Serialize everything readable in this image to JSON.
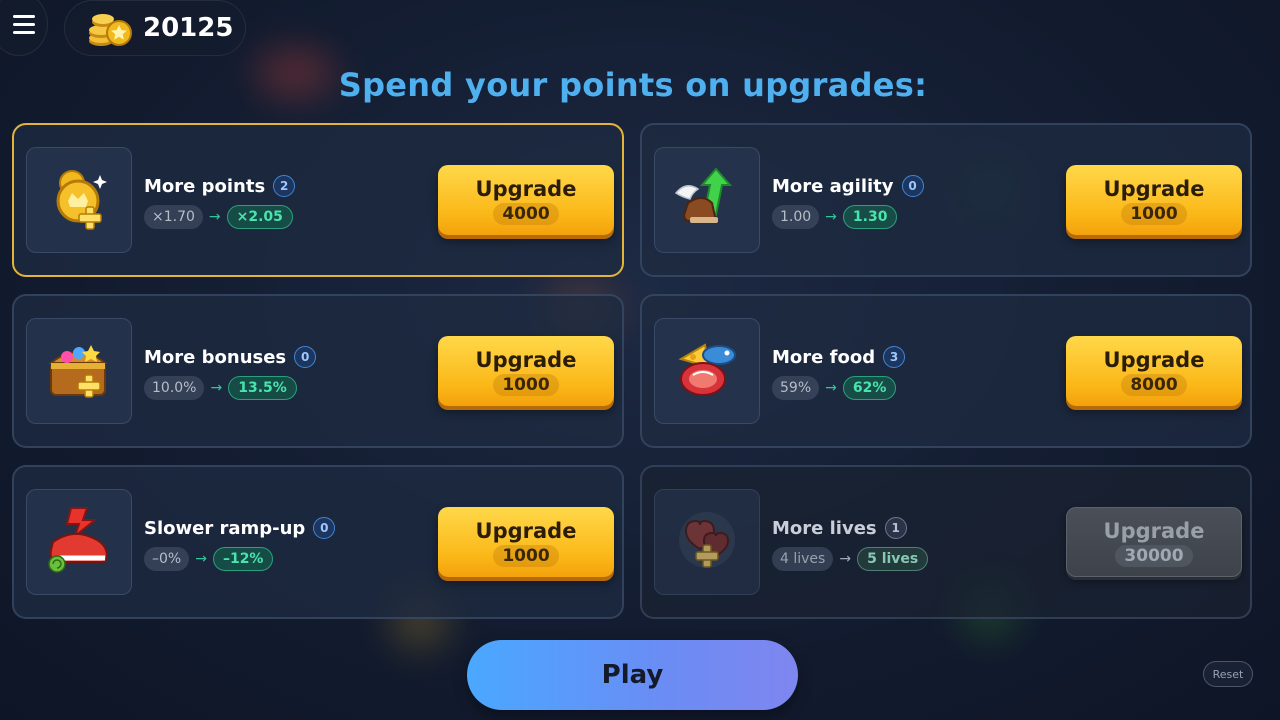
{
  "header": {
    "menu_icon": "hamburger-menu-icon",
    "coin_icon": "gold-coins-icon",
    "coins": "20125"
  },
  "headline": "Spend your points on upgrades:",
  "upgrades": [
    {
      "title": "More points",
      "level": "2",
      "old": "×1.70",
      "new": "×2.05",
      "button": "Upgrade",
      "cost": "4000",
      "icon": "gold-coin-plus-icon",
      "selected": true,
      "disabled": false
    },
    {
      "title": "More agility",
      "level": "0",
      "old": "1.00",
      "new": "1.30",
      "button": "Upgrade",
      "cost": "1000",
      "icon": "winged-boot-icon",
      "selected": false,
      "disabled": false
    },
    {
      "title": "More bonuses",
      "level": "0",
      "old": "10.0%",
      "new": "13.5%",
      "button": "Upgrade",
      "cost": "1000",
      "icon": "treasure-chest-icon",
      "selected": false,
      "disabled": false
    },
    {
      "title": "More food",
      "level": "3",
      "old": "59%",
      "new": "62%",
      "button": "Upgrade",
      "cost": "8000",
      "icon": "food-icon",
      "selected": false,
      "disabled": false
    },
    {
      "title": "Slower ramp-up",
      "level": "0",
      "old": "–0%",
      "new": "–12%",
      "button": "Upgrade",
      "cost": "1000",
      "icon": "red-sneaker-snail-icon",
      "selected": false,
      "disabled": false
    },
    {
      "title": "More lives",
      "level": "1",
      "old": "4 lives",
      "new": "5 lives",
      "button": "Upgrade",
      "cost": "30000",
      "icon": "hearts-plus-icon",
      "selected": false,
      "disabled": true
    }
  ],
  "arrow": "→",
  "play_label": "Play",
  "reset_label": "Reset",
  "colors": {
    "headline": "#4fb0f0",
    "upgrade_button": "#fbb818",
    "selected_border": "#e2b53a",
    "stat_new": "#49e3ad",
    "play_button": "#5a9cf8"
  }
}
